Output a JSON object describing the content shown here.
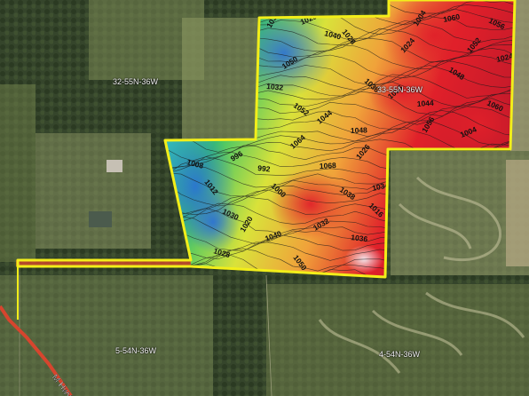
{
  "map": {
    "section_labels": [
      {
        "id": "sec-32-55n-36w",
        "text": "32-55N-36W"
      },
      {
        "id": "sec-33-55n-36w",
        "text": "33-55N-36W"
      },
      {
        "id": "sec-5-54n-36w",
        "text": "5-54N-36W"
      },
      {
        "id": "sec-4-54n-36w",
        "text": "4-54N-36W"
      }
    ],
    "road_label": "M Hwy",
    "contour_labels": [
      "1030",
      "1020",
      "1040",
      "1028",
      "1050",
      "1032",
      "1036",
      "1016",
      "1044",
      "1048",
      "1052",
      "1024",
      "1060",
      "1056",
      "1004",
      "1008",
      "1012",
      "996",
      "992",
      "1000",
      "1064",
      "1068",
      "1038",
      "1026",
      "1034"
    ],
    "colors": {
      "boundary": "#f2ee1a",
      "low_elevation": "#2a4fd8",
      "mid_elevation": "#d9e23a",
      "high_elevation": "#e0202a",
      "road": "#d6452e"
    }
  }
}
